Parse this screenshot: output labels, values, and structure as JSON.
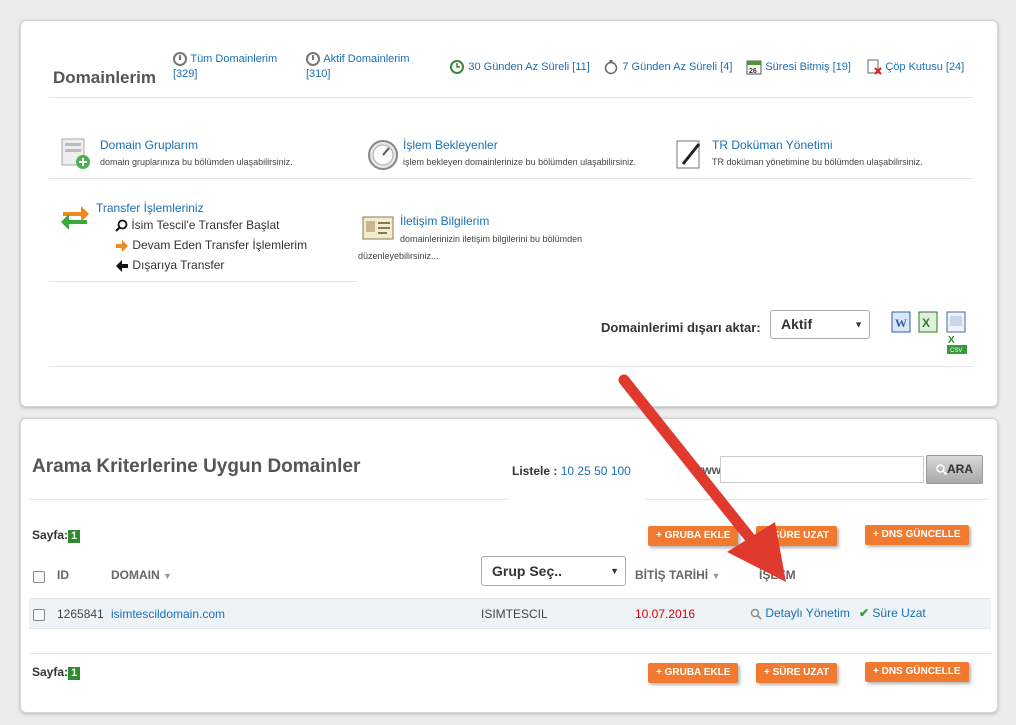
{
  "header": {
    "title": "Domainlerim",
    "all_domains": {
      "label": "Tüm Domainlerim",
      "count": "[329]"
    },
    "active_domains": {
      "label": "Aktif Domainlerim",
      "count": "[310]"
    },
    "less30": "30 Günden Az Süreli [11]",
    "less7": "7 Günden Az Süreli [4]",
    "expired": "Süresi Bitmiş [19]",
    "trash": "Çöp Kutusu [24]"
  },
  "features": {
    "groups": {
      "title": "Domain Gruplarım",
      "desc": "domain gruplarınıza bu bölümden ulaşabilirsiniz."
    },
    "pending": {
      "title": "İşlem Bekleyenler",
      "desc": "işlem bekleyen domainlerinize bu bölümden ulaşabilirsiniz."
    },
    "tr_docs": {
      "title": "TR Doküman Yönetimi",
      "desc": "TR doküman yönetimine bu bölümden ulaşabilirsiniz."
    },
    "transfer": {
      "title": "Transfer İşlemleriniz",
      "items": [
        "İsim Tescil'e Transfer Başlat",
        "Devam Eden Transfer İşlemlerim",
        "Dışarıya Transfer"
      ]
    },
    "contact": {
      "title": "İletişim Bilgilerim",
      "desc1": "domainlerinizin iletişim bilgilerini bu bölümden",
      "desc2": "düzenleyebilirsiniz..."
    }
  },
  "export": {
    "label": "Domainlerimi dışarı aktar:",
    "selected": "Aktif"
  },
  "search": {
    "title": "Arama Kriterlerine Uygun Domainler",
    "list_label": "Listele :",
    "list_options": [
      "10",
      "25",
      "50",
      "100"
    ],
    "www": "www.",
    "input_value": "",
    "button": "ARA"
  },
  "pagination": {
    "label": "Sayfa:",
    "page": "1"
  },
  "buttons": {
    "add_group": "+ GRUBA EKLE",
    "extend": "+ SÜRE UZAT",
    "dns": "+ DNS GÜNCELLE"
  },
  "table": {
    "headers": {
      "id": "ID",
      "domain": "DOMAIN",
      "group_select": "Grup Seç..",
      "expiry": "BİTİŞ TARİHİ",
      "action": "İŞLEM"
    },
    "rows": [
      {
        "id": "1265841",
        "domain": "isimtescildomain.com",
        "group": "ISIMTESCIL",
        "expiry": "10.07.2016",
        "detail": "Detaylı Yönetim",
        "extend": "Süre Uzat"
      }
    ]
  },
  "colors": {
    "link": "#1a6fb5",
    "orange": "#f07a30",
    "arrow": "#e03a2e",
    "expiry": "#e00000"
  }
}
